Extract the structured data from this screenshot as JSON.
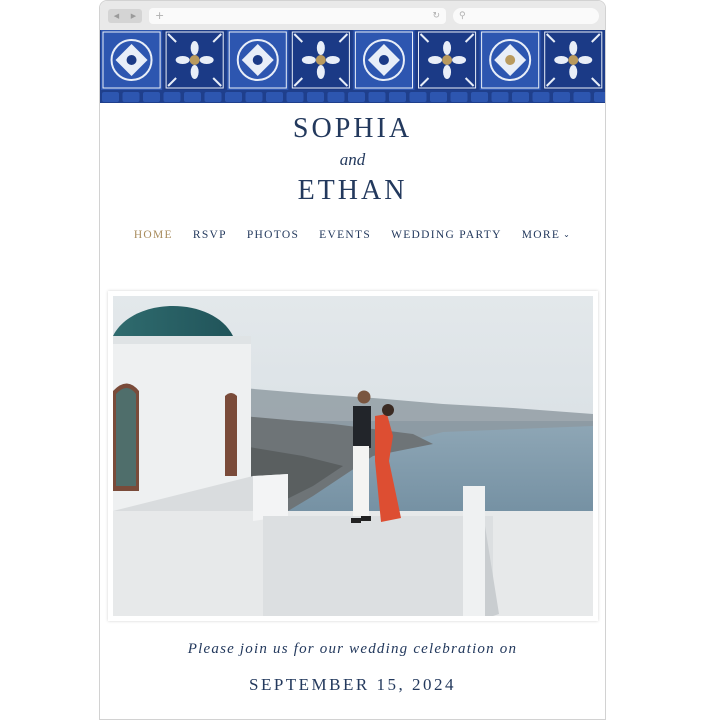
{
  "browser": {
    "back_icon": "back-arrow-icon",
    "forward_icon": "forward-arrow-icon",
    "new_tab_icon": "plus-icon",
    "reload_icon": "reload-icon",
    "search_icon": "magnifier-icon"
  },
  "site": {
    "name1": "SOPHIA",
    "and": "and",
    "name2": "ETHAN",
    "nav": {
      "home": "HOME",
      "rsvp": "RSVP",
      "photos": "PHOTOS",
      "events": "EVENTS",
      "wedding_party": "WEDDING PARTY",
      "more": "MORE"
    },
    "invite_text": "Please join us for our wedding celebration on",
    "date": "SEPTEMBER 15, 2024"
  },
  "colors": {
    "navy": "#23395d",
    "gold": "#a88b5c",
    "tile_blue": "#1f3f8c",
    "sea": "#6f8fa3"
  }
}
